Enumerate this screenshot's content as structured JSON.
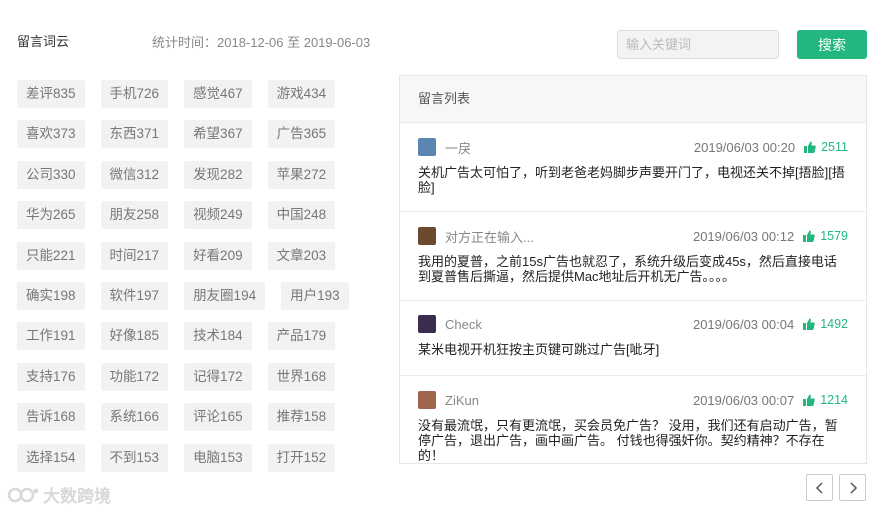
{
  "header": {
    "title": "留言词云",
    "stat_text": "统计时间：2018-12-06 至 2019-06-03"
  },
  "search": {
    "placeholder": "输入关键词",
    "button_label": "搜索"
  },
  "tags": [
    [
      "差评835",
      "手机726",
      "感觉467",
      "游戏434"
    ],
    [
      "喜欢373",
      "东西371",
      "希望367",
      "广告365"
    ],
    [
      "公司330",
      "微信312",
      "发现282",
      "苹果272"
    ],
    [
      "华为265",
      "朋友258",
      "视频249",
      "中国248"
    ],
    [
      "只能221",
      "时间217",
      "好看209",
      "文章203"
    ],
    [
      "确实198",
      "软件197",
      "朋友圈194",
      "用户193"
    ],
    [
      "工作191",
      "好像185",
      "技术184",
      "产品179"
    ],
    [
      "支持176",
      "功能172",
      "记得172",
      "世界168"
    ],
    [
      "告诉168",
      "系统166",
      "评论165",
      "推荐158"
    ],
    [
      "选择154",
      "不到153",
      "电脑153",
      "打开152"
    ]
  ],
  "panel": {
    "title": "留言列表",
    "messages": [
      {
        "user": "一戾",
        "time": "2019/06/03 00:20",
        "likes": "2511",
        "avatar_color": "#5b86b0",
        "text": "关机广告太可怕了，听到老爸老妈脚步声要开门了，电视还关不掉[捂脸][捂脸]"
      },
      {
        "user": "对方正在输入...",
        "time": "2019/06/03 00:12",
        "likes": "1579",
        "avatar_color": "#6b4a2e",
        "text": "我用的夏普，之前15s广告也就忍了，系统升级后变成45s，然后直接电话到夏普售后撕逼，然后提供Mac地址后开机无广告。。。。"
      },
      {
        "user": "Check",
        "time": "2019/06/03 00:04",
        "likes": "1492",
        "avatar_color": "#3a2d4f",
        "text": "某米电视开机狂按主页键可跳过广告[呲牙]"
      },
      {
        "user": "ZiKun",
        "time": "2019/06/03 00:07",
        "likes": "1214",
        "avatar_color": "#a0664b",
        "text": "没有最流氓，只有更流氓，买会员免广告？ 没用，我们还有启动广告，暂停广告，退出广告，画中画广告。 付钱也得强奸你。契约精神？不存在的！"
      }
    ]
  },
  "watermark": {
    "text": "大数跨境"
  },
  "colors": {
    "accent": "#21b77f",
    "tag_bg": "#f2f2f2"
  }
}
